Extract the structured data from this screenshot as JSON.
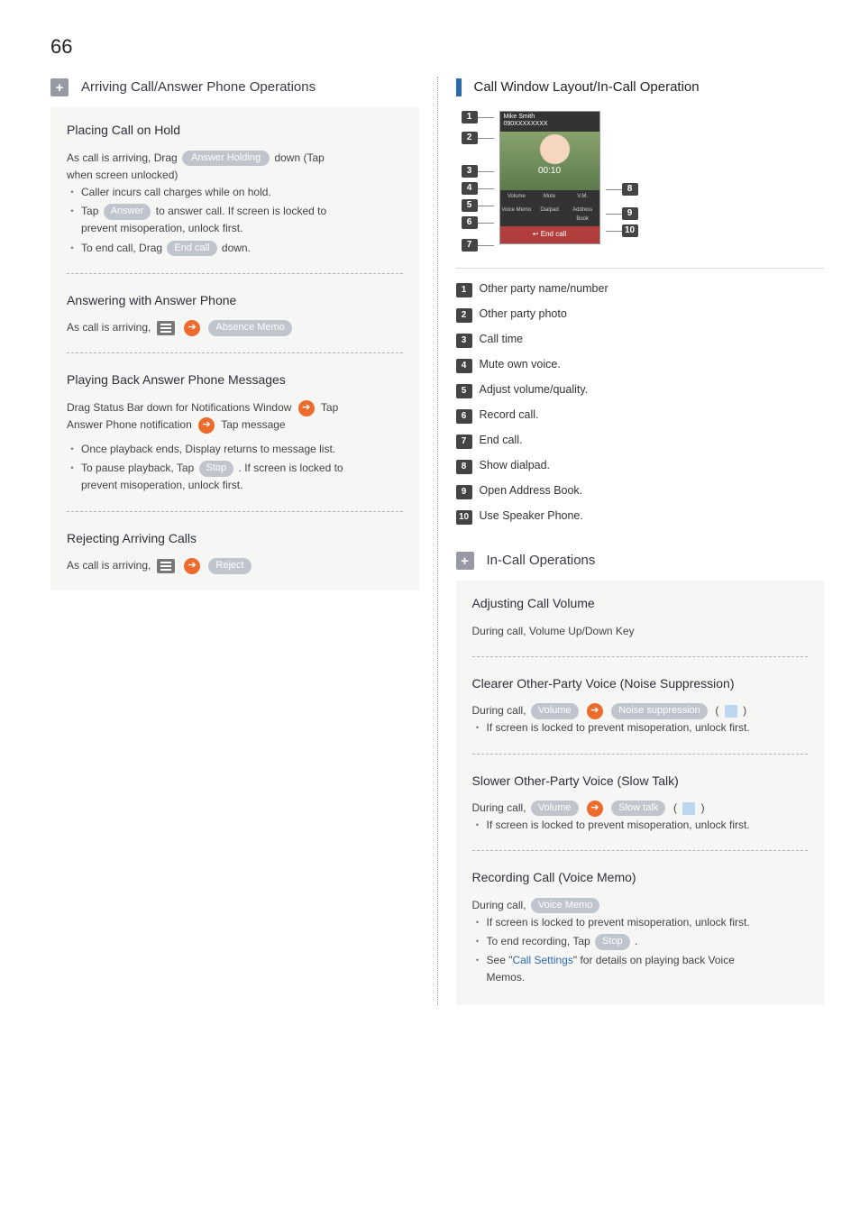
{
  "page_number": "66",
  "left": {
    "header": "Arriving Call/Answer Phone Operations",
    "sections": [
      {
        "title": "Placing Call on Hold",
        "lines": {
          "l1a": "As call is arriving, Drag ",
          "pill_hold": "Answer Holding",
          "l1b": " down (Tap",
          "l2": "when screen unlocked)",
          "b1": "Caller incurs call charges while on hold.",
          "b2a": "Tap ",
          "pill_answer": "Answer",
          "b2b": " to answer call. If screen is locked to",
          "b2c": "prevent misoperation, unlock first.",
          "b3a": "To end call, Drag ",
          "pill_end": "End call",
          "b3b": " down."
        }
      },
      {
        "title": "Answering with Answer Phone",
        "lines": {
          "l1": "As call is arriving, ",
          "pill_absence": "Absence Memo"
        }
      },
      {
        "title": "Playing Back Answer Phone Messages",
        "lines": {
          "l1": "Drag Status Bar down for Notifications Window ",
          "l1c": " Tap",
          "l2": "Answer Phone notification ",
          "l2c": " Tap message",
          "b1": "Once playback ends, Display returns to message list.",
          "b2a": "To pause playback, Tap ",
          "pill_stop": "Stop",
          "b2b": " . If screen is locked to",
          "b2c": "prevent misoperation, unlock first."
        }
      },
      {
        "title": "Rejecting Arriving Calls",
        "lines": {
          "l1": "As call is arriving, ",
          "pill_reject": "Reject"
        }
      }
    ]
  },
  "right": {
    "header1": "Call Window Layout/In-Call Operation",
    "screenshot": {
      "name": "Mike Smith",
      "num": "090XXXXXXXX",
      "time": "00:10",
      "row1": [
        "Volume",
        "Mute",
        "V.M."
      ],
      "row2": [
        "Voice Memo",
        "Dialpad",
        "Address Book"
      ],
      "end": "End call"
    },
    "legend": [
      "Other party name/number",
      "Other party photo",
      "Call time",
      "Mute own voice.",
      "Adjust volume/quality.",
      "Record call.",
      "End call.",
      "Show dialpad.",
      "Open Address Book.",
      "Use Speaker Phone."
    ],
    "header2": "In-Call Operations",
    "sections": [
      {
        "title": "Adjusting Call Volume",
        "lines": {
          "l1": "During call, Volume Up/Down Key"
        }
      },
      {
        "title": "Clearer Other-Party Voice (Noise Suppression)",
        "lines": {
          "l1": "During call, ",
          "pill_vol": "Volume",
          "pill_ns": "Noise suppression",
          "b1": "If screen is locked to prevent misoperation, unlock first."
        }
      },
      {
        "title": "Slower Other-Party Voice (Slow Talk)",
        "lines": {
          "l1": "During call, ",
          "pill_vol": "Volume",
          "pill_st": "Slow talk",
          "b1": "If screen is locked to prevent misoperation, unlock first."
        }
      },
      {
        "title": "Recording Call (Voice Memo)",
        "lines": {
          "l1": "During call, ",
          "pill_vm": "Voice Memo",
          "b1": "If screen is locked to prevent misoperation, unlock first.",
          "b2a": "To end recording, Tap ",
          "pill_stop": "Stop",
          "b2b": " .",
          "b3a": "See \"",
          "link": "Call Settings",
          "b3b": "\" for details on playing back Voice",
          "b3c": "Memos."
        }
      }
    ]
  }
}
